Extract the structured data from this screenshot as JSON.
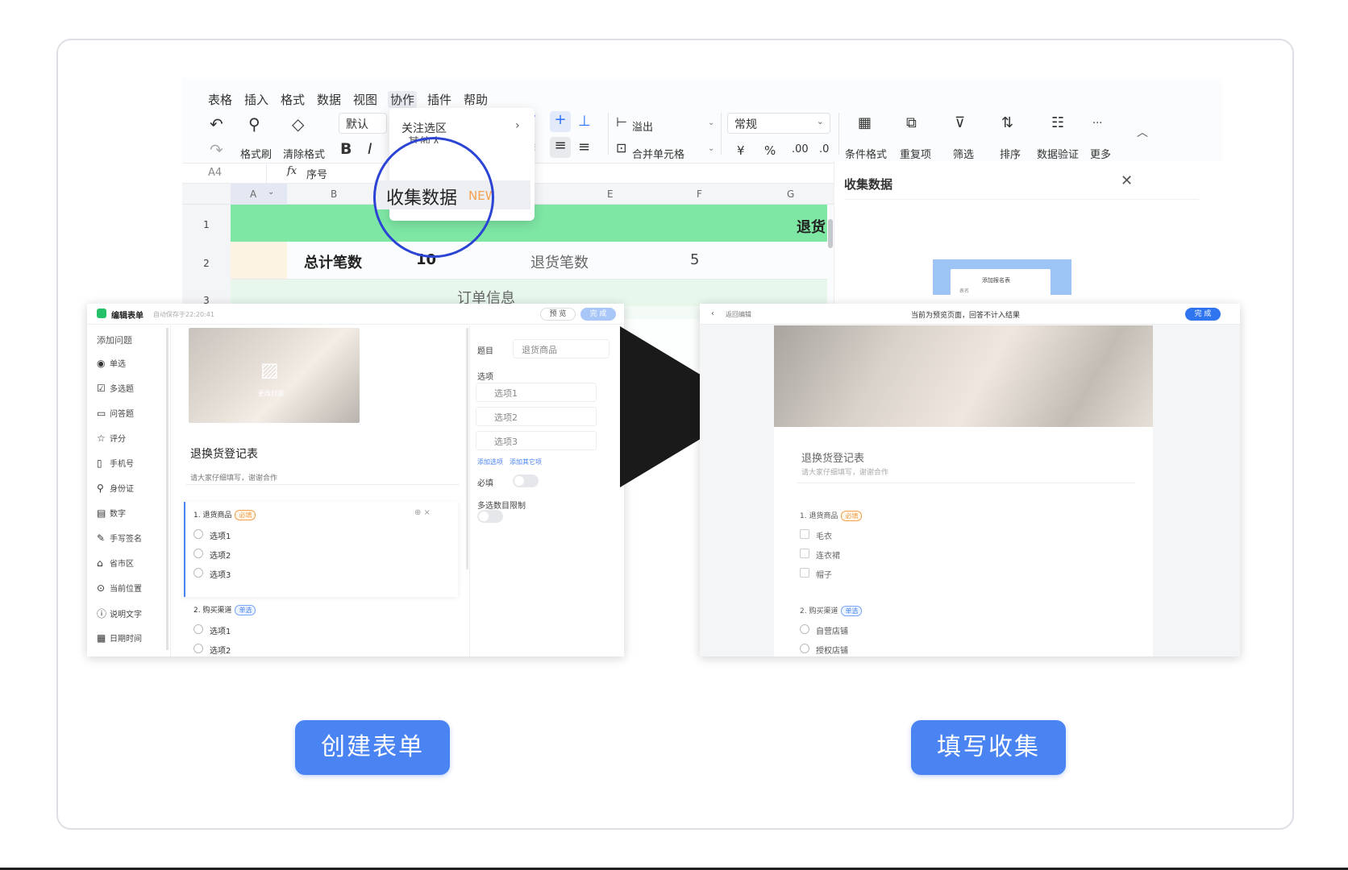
{
  "spreadsheet": {
    "menu": [
      "表格",
      "插入",
      "格式",
      "数据",
      "视图",
      "协作",
      "插件",
      "帮助"
    ],
    "toolbar": {
      "format_brush": "格式刷",
      "clear_format": "清除格式",
      "font_default": "默认",
      "bold": "B",
      "italic": "I",
      "overflow": "溢出",
      "merge_cells": "合并单元格",
      "number_format": "常规",
      "currency": "¥",
      "percent": "%",
      "decimal_inc": ".00",
      "decimal_dec": ".0",
      "conditional_format": "条件格式",
      "duplicates": "重复项",
      "filter": "筛选",
      "sort": "排序",
      "data_validation": "数据验证",
      "more": "更多",
      "ellipsis": "···"
    },
    "cell_ref": "A4",
    "fx": "fx",
    "formula": "序号",
    "columns": [
      "A",
      "B",
      "E",
      "F",
      "G"
    ],
    "rows": [
      "1",
      "2",
      "3"
    ],
    "cells": {
      "total_label": "总计笔数",
      "total_value": "10",
      "return_label": "退货笔数",
      "return_value": "5",
      "order_info": "订单信息",
      "return_partial": "退货"
    },
    "dropdown": {
      "item1": "关注选区",
      "item2_partial": "其他人",
      "highlight": "收集数据",
      "badge": "NEW"
    },
    "side_panel": {
      "title": "收集数据",
      "preview_text": "添加报名表",
      "preview_small": "表名"
    }
  },
  "editor": {
    "title": "编辑表单",
    "autosave": "自动保存于22:20:41",
    "preview": "预 览",
    "done": "完 成",
    "add_question": "添加问题",
    "question_types": [
      {
        "icon": "◉",
        "label": "单选"
      },
      {
        "icon": "☑",
        "label": "多选题"
      },
      {
        "icon": "▭",
        "label": "问答题"
      },
      {
        "icon": "☆",
        "label": "评分"
      },
      {
        "icon": "▯",
        "label": "手机号"
      },
      {
        "icon": "⚲",
        "label": "身份证"
      },
      {
        "icon": "▤",
        "label": "数字"
      },
      {
        "icon": "✎",
        "label": "手写签名"
      },
      {
        "icon": "⌂",
        "label": "省市区"
      },
      {
        "icon": "⊙",
        "label": "当前位置"
      },
      {
        "icon": "ⓘ",
        "label": "说明文字"
      },
      {
        "icon": "▦",
        "label": "日期时间"
      }
    ],
    "cover_label": "更改封面",
    "form_title": "退换货登记表",
    "form_desc": "请大家仔细填写，谢谢合作",
    "q1": {
      "title": "1. 退货商品",
      "tag": "必填",
      "options": [
        "选项1",
        "选项2",
        "选项3"
      ]
    },
    "q2": {
      "title": "2. 购买渠道",
      "tag": "单选",
      "options": [
        "选项1",
        "选项2"
      ]
    },
    "props": {
      "topic_label": "题目",
      "topic_value": "退货商品",
      "options_label": "选项",
      "options": [
        "选项1",
        "选项2",
        "选项3"
      ],
      "add_option": "添加选项",
      "add_other": "添加其它项",
      "required": "必填",
      "multi_limit": "多选数目限制"
    }
  },
  "preview_shot": {
    "back": "返回编辑",
    "notice": "当前为预览页面，回答不计入结果",
    "done": "完 成",
    "form_title": "退换货登记表",
    "form_desc": "请大家仔细填写，谢谢合作",
    "q1": {
      "title": "1. 退货商品",
      "tag": "必填",
      "options": [
        "毛衣",
        "连衣裙",
        "帽子"
      ]
    },
    "q2": {
      "title": "2. 购买渠道",
      "tag": "单选",
      "options": [
        "自营店铺",
        "授权店铺"
      ]
    }
  },
  "buttons": {
    "create": "创建表单",
    "fill": "填写收集"
  },
  "colors": {
    "accent": "#4a84f2",
    "green_band": "#7ee7a4",
    "magnifier": "#2b44d4",
    "badge": "#f5a14b"
  }
}
